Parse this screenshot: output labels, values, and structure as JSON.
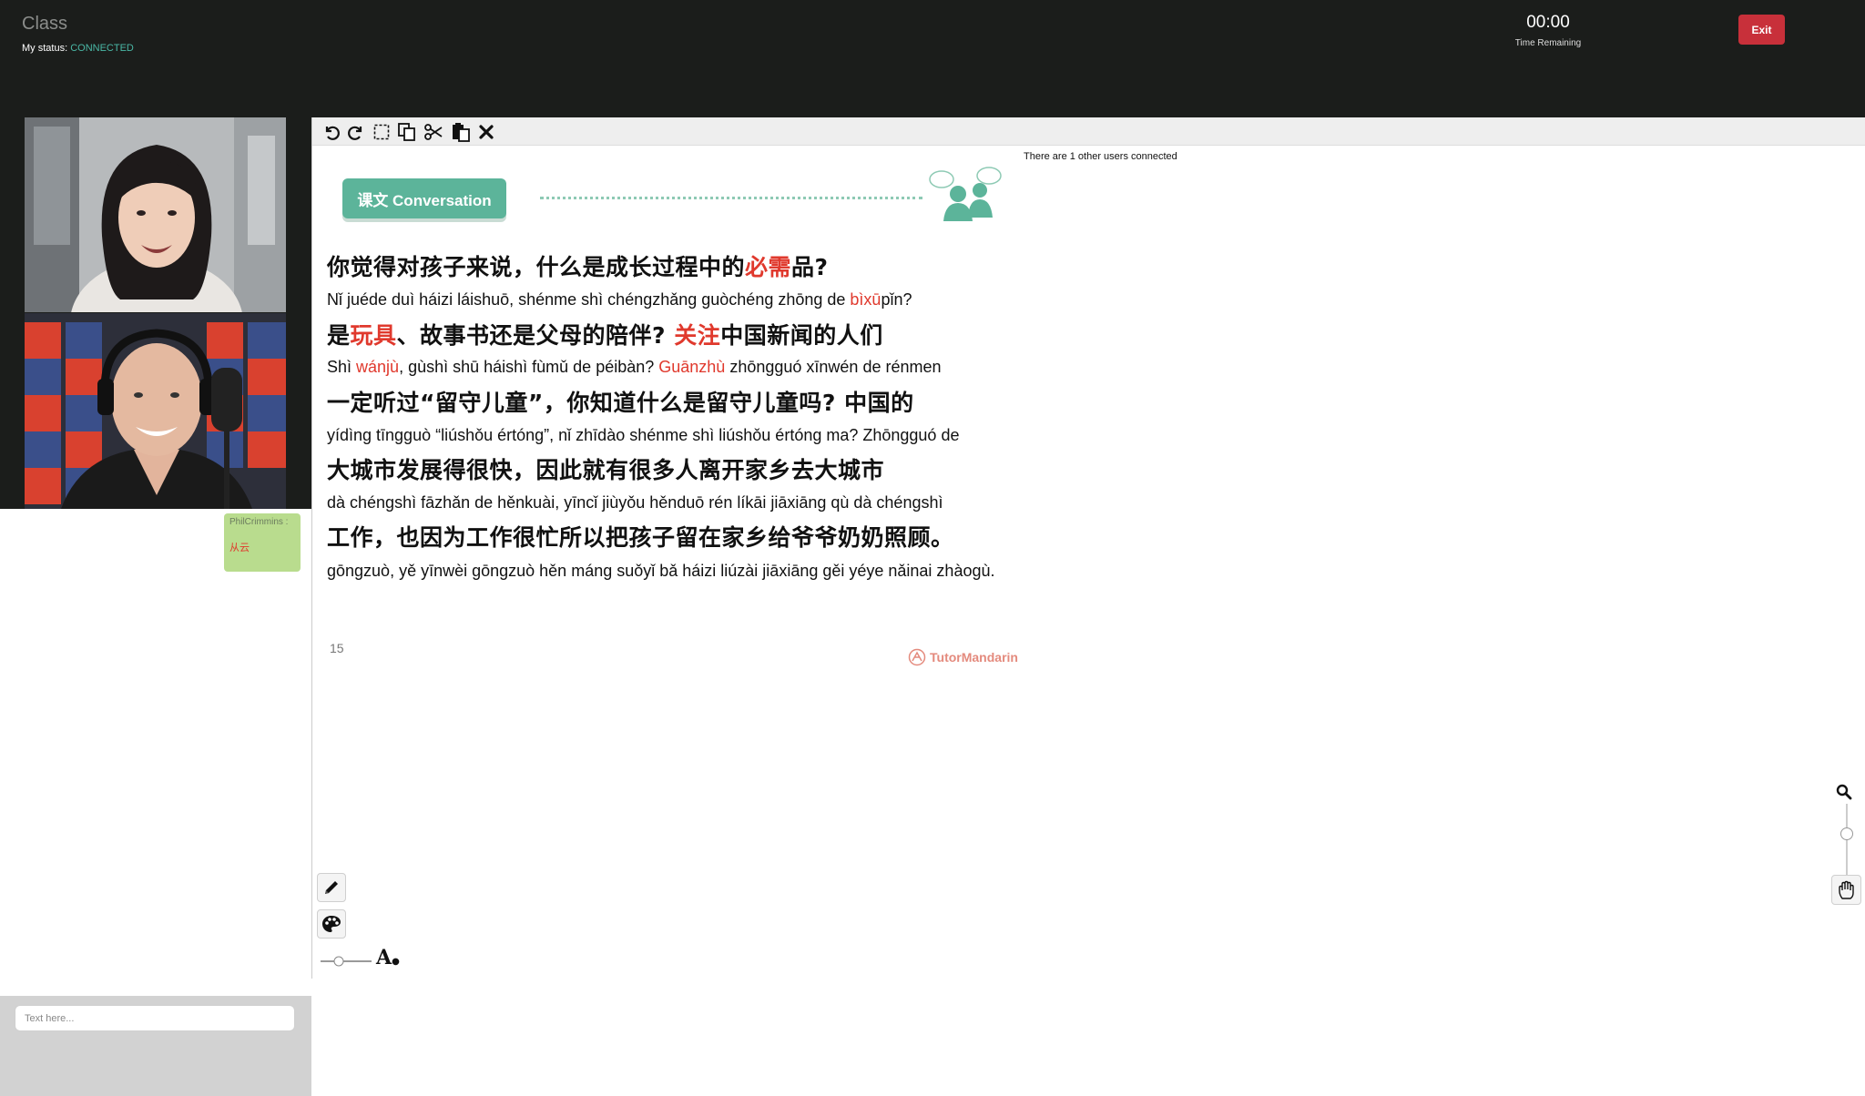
{
  "header": {
    "title": "Class",
    "status_label": "My status:",
    "status_value": "CONNECTED",
    "timer_value": "00:00",
    "timer_label": "Time Remaining",
    "exit_label": "Exit"
  },
  "colors": {
    "topbar": "#1b1d1b",
    "status_connected": "#4ab8a6",
    "exit_button": "#c8303a",
    "chat_bubble": "#b9dc8e",
    "highlight_red": "#e0392d",
    "accent_green": "#5cb49a"
  },
  "toolbar": {
    "tools": [
      "undo-icon",
      "redo-icon",
      "select-area-icon",
      "copy-icon",
      "cut-icon",
      "paste-icon",
      "delete-icon"
    ]
  },
  "board": {
    "users_connected": "There are 1 other users connected"
  },
  "slide": {
    "section_title": "课文 Conversation",
    "page_number": "15",
    "brand": "TutorMandarin",
    "lines": {
      "cn1": {
        "a": "你觉得对孩子来说，什么是成长过程中的",
        "b": "必需",
        "c": "品?"
      },
      "py1": {
        "a": "Nǐ juéde duì háizi láishuō, shénme shì chéngzhǎng guòchéng zhōng de ",
        "b": "bìxū",
        "c": "pǐn?"
      },
      "cn2": {
        "a": "是",
        "b": "玩具",
        "c": "、故事书还是父母的陪伴? ",
        "d": "关注",
        "e": "中国新闻的人们"
      },
      "py2": {
        "a": "Shì ",
        "b": "wánjù",
        "c": ", gùshì shū háishì fùmǔ de péibàn? ",
        "d": "Guānzhù",
        "e": " zhōngguó xīnwén de rénmen"
      },
      "cn3": "一定听过“留守儿童”，你知道什么是留守儿童吗? 中国的",
      "py3": "yídìng tīngguò “liúshǒu értóng”, nǐ zhīdào shénme shì liúshǒu értóng ma? Zhōngguó de",
      "cn4": "大城市发展得很快，因此就有很多人离开家乡去大城市",
      "py4": "dà chéngshì fāzhǎn de hěnkuài, yīncǐ jiùyǒu hěnduō rén líkāi jiāxiāng qù dà chéngshì",
      "cn5": "工作，也因为工作很忙所以把孩子留在家乡给爷爷奶奶照顾。",
      "py5": "gōngzuò, yě yīnwèi gōngzuò hěn máng suǒyǐ bǎ háizi liúzài jiāxiāng gěi yéye nǎinai zhàogù."
    }
  },
  "chat": {
    "messages": [
      {
        "user": "PhilCrimmins :",
        "text": "从云"
      }
    ],
    "input_placeholder": "Text here..."
  },
  "drawing_tools": [
    "pencil-icon",
    "palette-icon",
    "font-size-icon"
  ],
  "zoom_tools": [
    "zoom-icon",
    "hand-tool-icon"
  ]
}
